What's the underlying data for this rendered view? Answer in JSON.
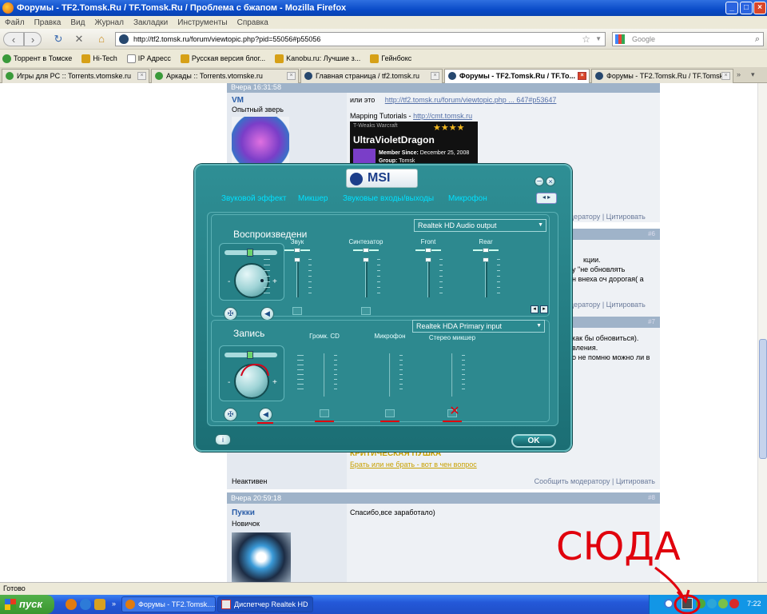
{
  "window": {
    "title": "Форумы - TF2.Tomsk.Ru / TF.Tomsk.Ru / Проблема с бжапом - Mozilla Firefox",
    "controls": [
      "_",
      "□",
      "×"
    ]
  },
  "menu": [
    "Файл",
    "Правка",
    "Вид",
    "Журнал",
    "Закладки",
    "Инструменты",
    "Справка"
  ],
  "nav": {
    "url": "http://tf2.tomsk.ru/forum/viewtopic.php?pid=55056#p55056",
    "search_placeholder": "Google"
  },
  "bookmarks": [
    {
      "label": "Торрент в Томске",
      "color": "#3a9a3a"
    },
    {
      "label": "Hi-Tech",
      "color": "#d6a017"
    },
    {
      "label": "IP Адресс",
      "color": "#ffffff"
    },
    {
      "label": "Русская версия блог...",
      "color": "#d6a017"
    },
    {
      "label": "Kanobu.ru: Лучшие з...",
      "color": "#d6a017"
    },
    {
      "label": "Гейнбокс",
      "color": "#d6a017"
    }
  ],
  "tabs": [
    {
      "label": "Игры для PC :: Torrents.vtomske.ru",
      "icon": "#3a9a3a",
      "active": false
    },
    {
      "label": "Аркады :: Torrents.vtomske.ru",
      "icon": "#3a9a3a",
      "active": false
    },
    {
      "label": "Главная страница / tf2.tomsk.ru",
      "icon": "#26476e",
      "active": false
    },
    {
      "label": "Форумы - TF2.Tomsk.Ru / TF.To...",
      "icon": "#26476e",
      "active": true
    },
    {
      "label": "Форумы - TF2.Tomsk.Ru / TF.Tomsk...",
      "icon": "#26476e",
      "active": false
    }
  ],
  "forum": {
    "post1": {
      "time": "Вчера 16:31:58",
      "author": "VM",
      "rank": "Опытный зверь",
      "text": "или это",
      "link": "http://tf2.tomsk.ru/forum/viewtopic.php ... 647#p53647",
      "sig_label": "Mapping Tutorials -",
      "sig_link": "http://cmt.tomsk.ru",
      "badge_name": "UltraVioletDragon",
      "badge_site": "T-Weaks Warcraft",
      "badge_member": "Member Since:",
      "badge_date": "December 25, 2008",
      "badge_group": "Group:",
      "badge_group_val": "Tomsk",
      "report": "Сообщить модератору",
      "quote": "Цитировать"
    },
    "side_texts": {
      "r1": "одератору",
      "q1": "Цитировать",
      "n6": "#6",
      "t1": "кции.",
      "t2": "у \"не обновлять",
      "t3": "н внеха оч дорогая( а",
      "r2": "одератору",
      "q2": "Цитировать",
      "n7": "#7",
      "t4": "как бы обновиться).",
      "t5": "вления.",
      "t6": "о не помню можно ли в"
    },
    "post2_tail": {
      "sig_caption": "КРИТИЧЕСКАЯ ПУШКА",
      "sig_link": "Брать или не брать - вот в чен вопрос",
      "status": "Неактивен",
      "report": "Сообщить модератору",
      "quote": "Цитировать"
    },
    "post3": {
      "time": "Вчера 20:59:18",
      "num": "#8",
      "author": "Пукки",
      "rank": "Новичок",
      "text": "Спасибо,все заработало)"
    }
  },
  "dialog": {
    "brand": "MSI",
    "tabs": [
      "Звуковой эффект",
      "Микшер",
      "Звуковые входы/выходы",
      "Микрофон"
    ],
    "playback": {
      "title": "Воспроизведени",
      "device": "Realtek HD Audio output",
      "channels": [
        "Звук",
        "Синтезатор",
        "Front",
        "Rear"
      ]
    },
    "record": {
      "title": "Запись",
      "device": "Realtek HDA Primary input",
      "channels": [
        "Громк. CD",
        "Микрофон",
        "Стерео микшер"
      ]
    },
    "ok": "OK"
  },
  "status": "Готово",
  "taskbar": {
    "start": "пуск",
    "tasks": [
      "Форумы - TF2.Tomsk....",
      "Диспетчер Realtek HD"
    ],
    "lang": "RL",
    "clock": "7:22"
  },
  "annotation": {
    "text": "СЮДА"
  }
}
